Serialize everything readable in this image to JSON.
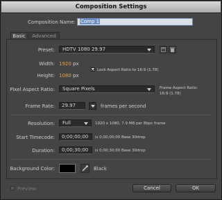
{
  "window": {
    "title": "Composition Settings"
  },
  "composition": {
    "name_label": "Composition Name:",
    "name_value": "Comp 1"
  },
  "tabs": [
    {
      "label": "Basic"
    },
    {
      "label": "Advanced"
    }
  ],
  "preset": {
    "label": "Preset:",
    "value": "HDTV 1080 29.97"
  },
  "width": {
    "label": "Width:",
    "value": "1920",
    "unit": "px"
  },
  "height": {
    "label": "Height:",
    "value": "1080",
    "unit": "px"
  },
  "lock_aspect": {
    "label": "Lock Aspect Ratio to 16:9 (1.78)",
    "checked": true
  },
  "pixel_aspect": {
    "label": "Pixel Aspect Ratio:",
    "value": "Square Pixels",
    "frame_aspect_label": "Frame Aspect Ratio:",
    "frame_aspect_value": "16:9 (1.78)"
  },
  "frame_rate": {
    "label": "Frame Rate:",
    "value": "29.97",
    "unit": "frames per second"
  },
  "resolution": {
    "label": "Resolution:",
    "value": "Full",
    "info": "1920 x 1080, 7.9 MB per 8bpc frame"
  },
  "start_timecode": {
    "label": "Start Timecode:",
    "value": "0;00;00;00",
    "info": "is 0;00;00;00  Base 30drop"
  },
  "duration": {
    "label": "Duration:",
    "value": "0;00;30;00",
    "info": "is 0;00;30;00  Base 30drop"
  },
  "background": {
    "label": "Background Color:",
    "color_name": "Black",
    "color_hex": "#000000"
  },
  "footer": {
    "preview_label": "Preview",
    "cancel_label": "Cancel",
    "ok_label": "OK"
  }
}
